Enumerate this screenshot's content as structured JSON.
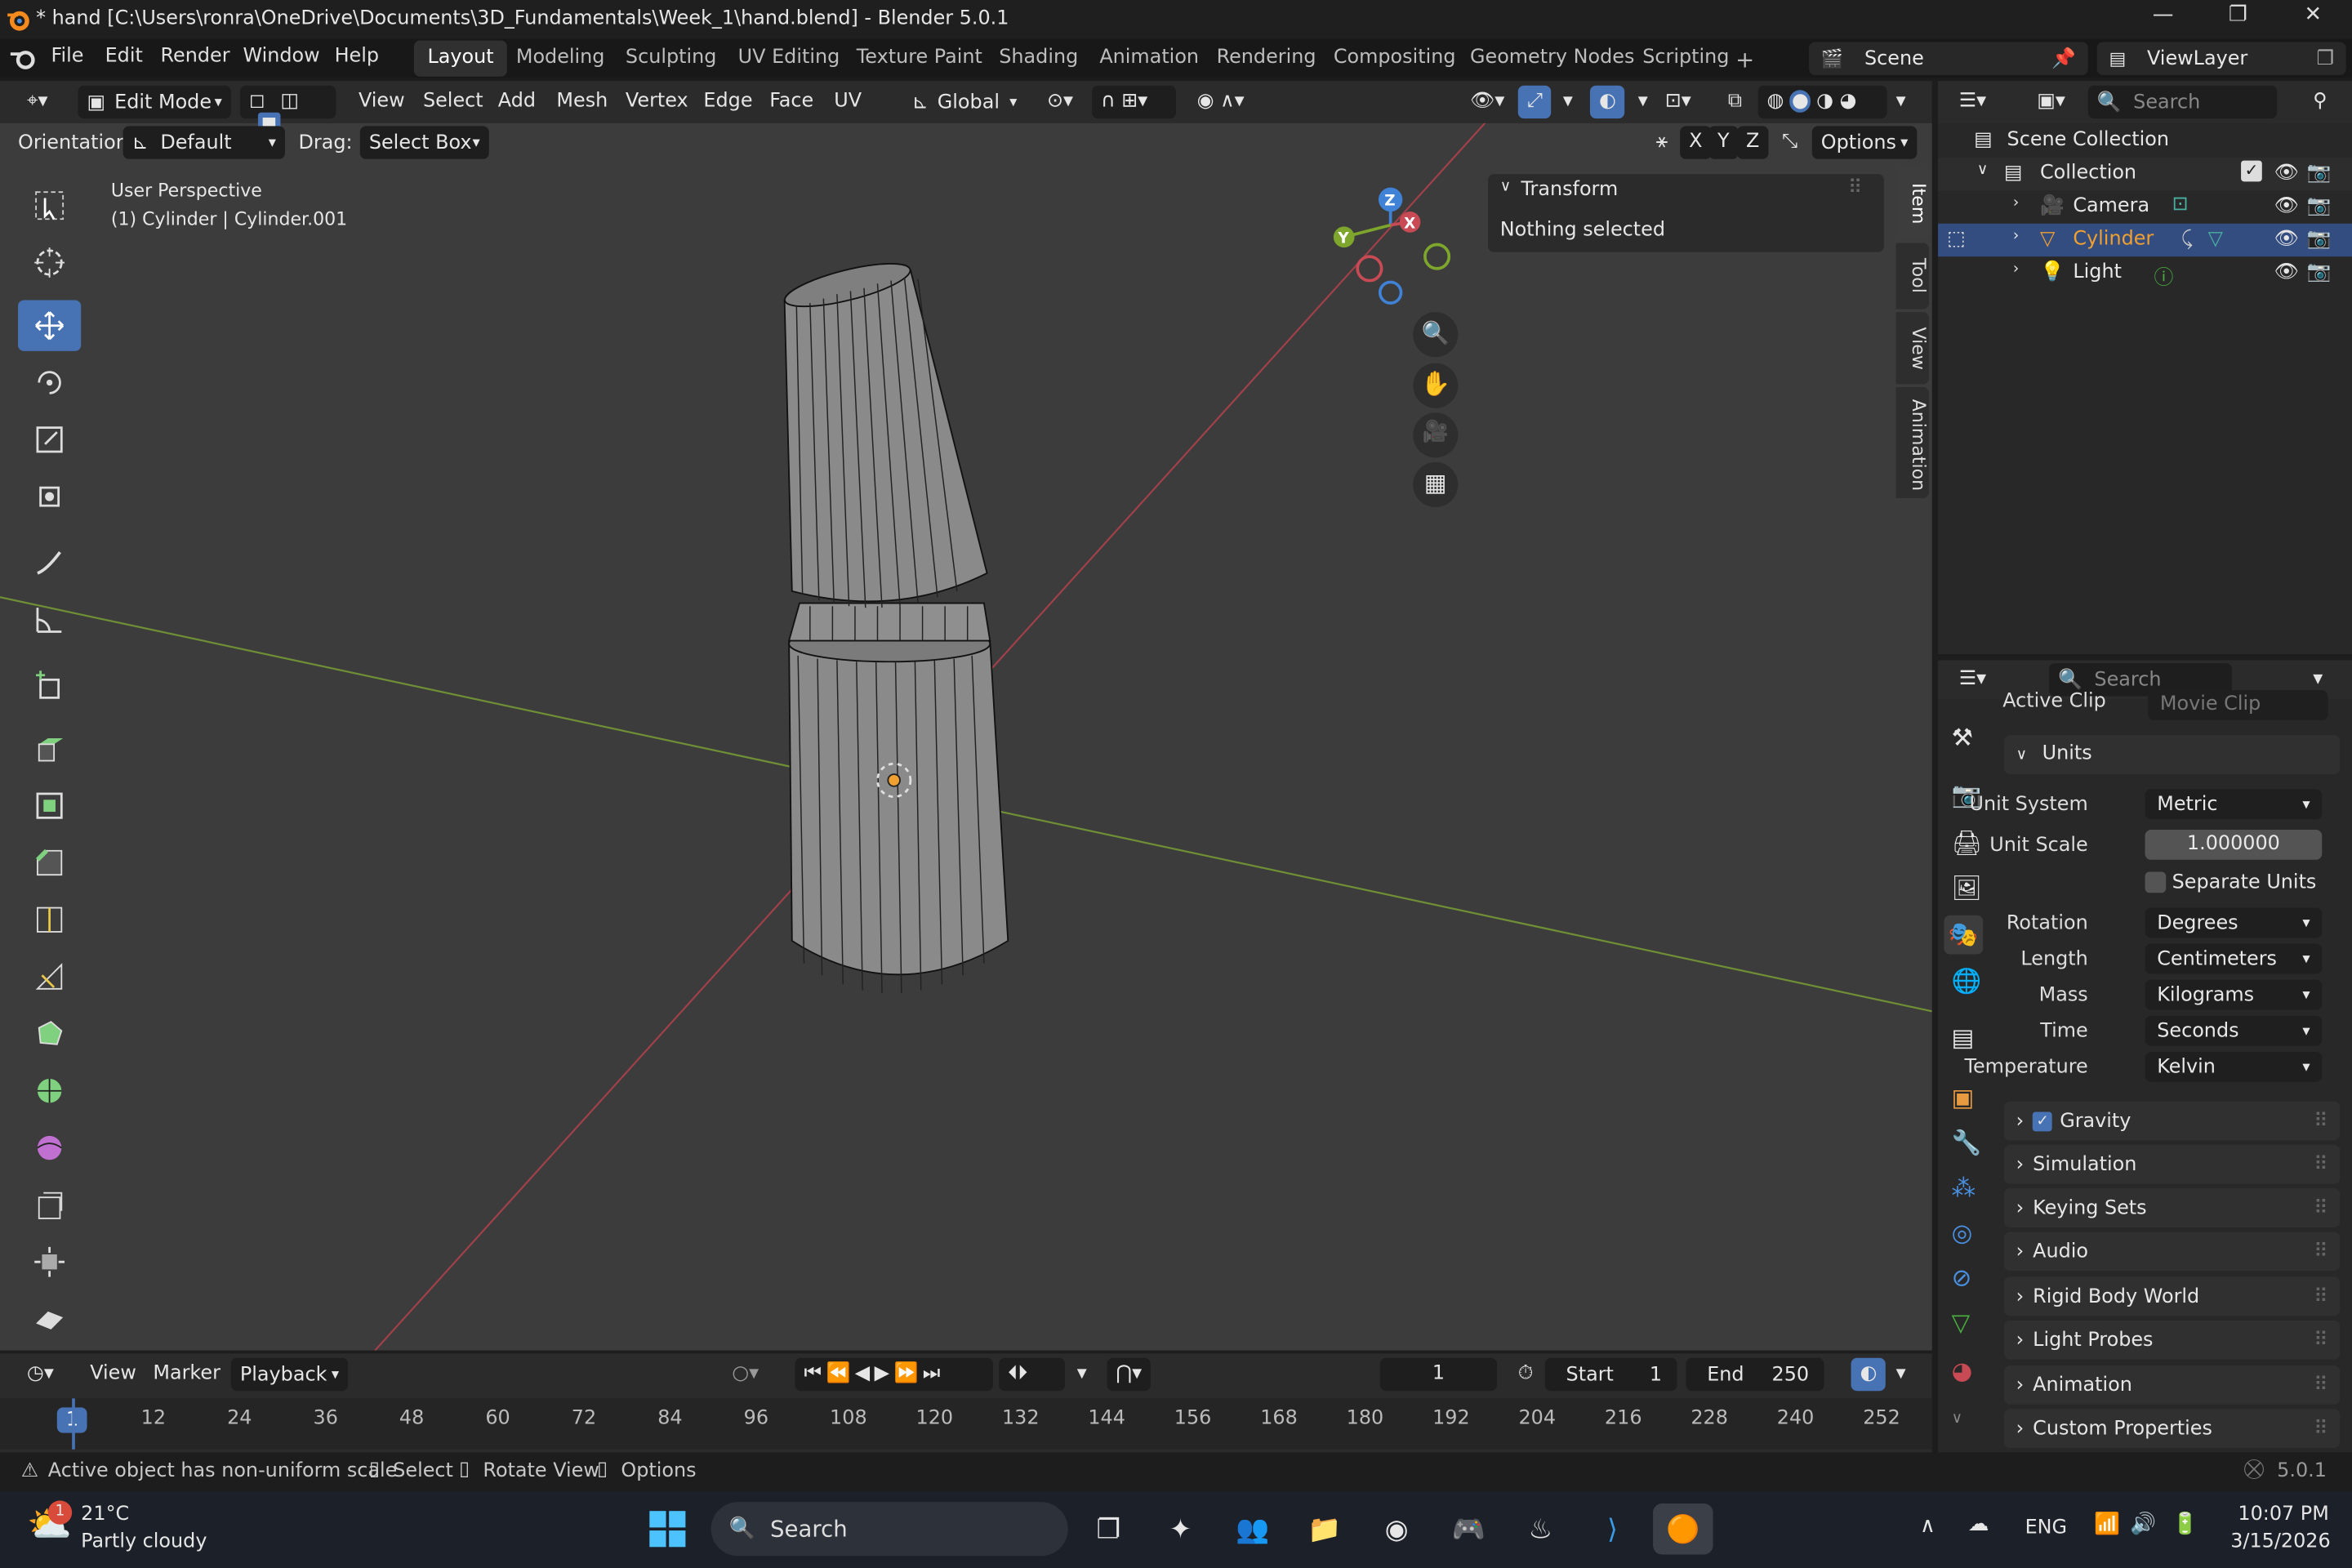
{
  "window": {
    "title": "* hand [C:\\Users\\ronra\\OneDrive\\Documents\\3D_Fundamentals\\Week_1\\hand.blend] - Blender 5.0.1",
    "minimize": "—",
    "maximize": "❐",
    "close": "✕"
  },
  "menu": {
    "items": [
      "File",
      "Edit",
      "Render",
      "Window",
      "Help"
    ],
    "workspaces": [
      "Layout",
      "Modeling",
      "Sculpting",
      "UV Editing",
      "Texture Paint",
      "Shading",
      "Animation",
      "Rendering",
      "Compositing",
      "Geometry Nodes",
      "Scripting"
    ],
    "add_tab": "+",
    "scene_name": "Scene",
    "view_layer": "ViewLayer"
  },
  "header3d": {
    "mode": "Edit Mode",
    "menus": [
      "View",
      "Select",
      "Add",
      "Mesh",
      "Vertex",
      "Edge",
      "Face",
      "UV"
    ],
    "transform_orientation": "Global",
    "axes": [
      "X",
      "Y",
      "Z"
    ],
    "options": "Options"
  },
  "toolrow": {
    "orientation_label": "Orientation:",
    "orientation_value": "Default",
    "drag_label": "Drag:",
    "drag_value": "Select Box"
  },
  "viewport": {
    "perspective": "User Perspective",
    "object_info": "(1) Cylinder | Cylinder.001",
    "gizmo": {
      "x": "X",
      "y": "Y",
      "z": "Z"
    }
  },
  "npanel": {
    "section": "Transform",
    "message": "Nothing selected",
    "tabs": [
      "Item",
      "Tool",
      "View",
      "Animation"
    ]
  },
  "outliner": {
    "search_placeholder": "Search",
    "root": "Scene Collection",
    "collection": "Collection",
    "items": [
      {
        "name": "Camera",
        "selected": false
      },
      {
        "name": "Cylinder",
        "selected": true
      },
      {
        "name": "Light",
        "selected": false
      }
    ]
  },
  "properties": {
    "search_placeholder": "Search",
    "clipped_label": "Active Clip",
    "clipped_value": "Movie Clip",
    "units_header": "Units",
    "unit_system_label": "Unit System",
    "unit_system": "Metric",
    "unit_scale_label": "Unit Scale",
    "unit_scale": "1.000000",
    "separate_units": "Separate Units",
    "rotation_label": "Rotation",
    "rotation": "Degrees",
    "length_label": "Length",
    "length": "Centimeters",
    "mass_label": "Mass",
    "mass": "Kilograms",
    "time_label": "Time",
    "time": "Seconds",
    "temperature_label": "Temperature",
    "temperature": "Kelvin",
    "panels": [
      "Gravity",
      "Simulation",
      "Keying Sets",
      "Audio",
      "Rigid Body World",
      "Light Probes",
      "Animation",
      "Custom Properties"
    ]
  },
  "timeline": {
    "menus": [
      "View",
      "Marker",
      "Playback"
    ],
    "current_frame": "1",
    "start_label": "Start",
    "start": "1",
    "end_label": "End",
    "end": "250",
    "ruler": [
      "1",
      "12",
      "24",
      "36",
      "48",
      "60",
      "72",
      "84",
      "96",
      "108",
      "120",
      "132",
      "144",
      "156",
      "168",
      "180",
      "192",
      "204",
      "216",
      "228",
      "240",
      "252"
    ]
  },
  "status": {
    "warning": "Active object has non-uniform scale",
    "select": "Select",
    "rotate": "Rotate View",
    "options": "Options",
    "version": "5.0.1"
  },
  "taskbar": {
    "temperature": "21°C",
    "weather": "Partly cloudy",
    "weather_badge": "1",
    "search": "Search",
    "language": "ENG",
    "time": "10:07 PM",
    "date": "3/15/2026"
  },
  "colors": {
    "accent": "#4772b3",
    "x_axis": "#c84a55",
    "y_axis": "#7ea52c",
    "z_axis": "#3f82d6",
    "selected_object": "#f0a030"
  }
}
